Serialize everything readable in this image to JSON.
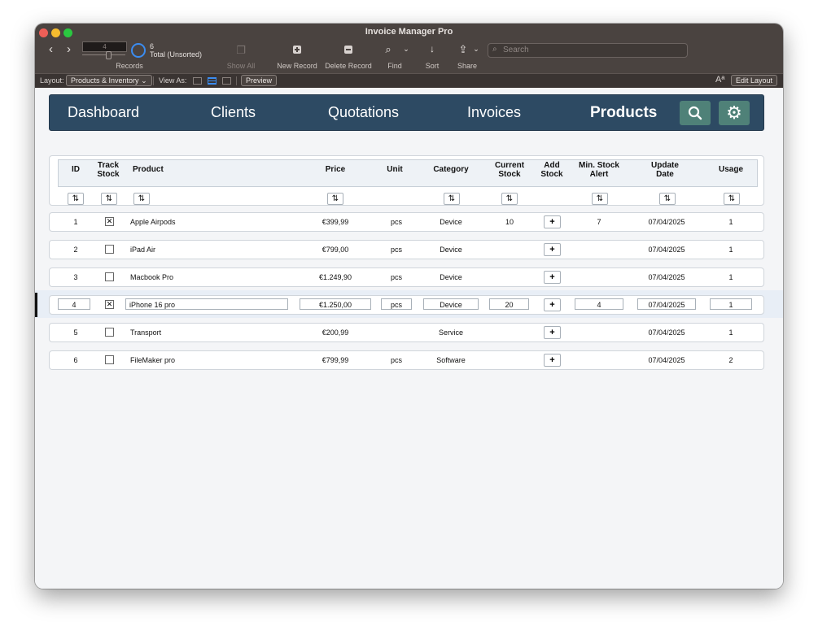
{
  "window": {
    "title": "Invoice Manager Pro"
  },
  "toolbar": {
    "current_record": "4",
    "total_count": "6",
    "total_label": "Total (Unsorted)",
    "records_label": "Records",
    "show_all_label": "Show All",
    "new_record_label": "New Record",
    "delete_record_label": "Delete Record",
    "find_label": "Find",
    "sort_label": "Sort",
    "share_label": "Share",
    "search_placeholder": "Search"
  },
  "layoutbar": {
    "layout_label": "Layout:",
    "layout_value": "Products & Inventory",
    "view_as_label": "View As:",
    "preview_label": "Preview",
    "font_icon_text": "Aª",
    "edit_layout_label": "Edit Layout"
  },
  "nav": {
    "items": [
      {
        "label": "Dashboard"
      },
      {
        "label": "Clients"
      },
      {
        "label": "Quotations"
      },
      {
        "label": "Invoices"
      },
      {
        "label": "Products"
      }
    ],
    "active": "Products"
  },
  "table": {
    "headers": [
      {
        "key": "id",
        "label": "ID"
      },
      {
        "key": "track_stock",
        "label": "Track Stock"
      },
      {
        "key": "product",
        "label": "Product"
      },
      {
        "key": "price",
        "label": "Price"
      },
      {
        "key": "unit",
        "label": "Unit"
      },
      {
        "key": "category",
        "label": "Category"
      },
      {
        "key": "current_stock",
        "label": "Current Stock"
      },
      {
        "key": "add_stock",
        "label": "Add Stock"
      },
      {
        "key": "min_stock_alert",
        "label": "Min. Stock Alert"
      },
      {
        "key": "update_date",
        "label": "Update Date"
      },
      {
        "key": "usage",
        "label": "Usage"
      }
    ],
    "rows": [
      {
        "id": "1",
        "track_stock": true,
        "product": "Apple Airpods",
        "price": "€399,99",
        "unit": "pcs",
        "category": "Device",
        "current_stock": "10",
        "min_stock_alert": "7",
        "update_date": "07/04/2025",
        "usage": "1"
      },
      {
        "id": "2",
        "track_stock": false,
        "product": "iPad Air",
        "price": "€799,00",
        "unit": "pcs",
        "category": "Device",
        "current_stock": "",
        "min_stock_alert": "",
        "update_date": "07/04/2025",
        "usage": "1"
      },
      {
        "id": "3",
        "track_stock": false,
        "product": "Macbook Pro",
        "price": "€1.249,90",
        "unit": "pcs",
        "category": "Device",
        "current_stock": "",
        "min_stock_alert": "",
        "update_date": "07/04/2025",
        "usage": "1"
      },
      {
        "id": "4",
        "track_stock": true,
        "product": "iPhone 16 pro",
        "price": "€1.250,00",
        "unit": "pcs",
        "category": "Device",
        "current_stock": "20",
        "min_stock_alert": "4",
        "update_date": "07/04/2025",
        "usage": "1"
      },
      {
        "id": "5",
        "track_stock": false,
        "product": "Transport",
        "price": "€200,99",
        "unit": "",
        "category": "Service",
        "current_stock": "",
        "min_stock_alert": "",
        "update_date": "07/04/2025",
        "usage": "1"
      },
      {
        "id": "6",
        "track_stock": false,
        "product": "FileMaker pro",
        "price": "€799,99",
        "unit": "pcs",
        "category": "Software",
        "current_stock": "",
        "min_stock_alert": "",
        "update_date": "07/04/2025",
        "usage": "2"
      }
    ],
    "selected_row_index": 3,
    "add_stock_symbol": "+",
    "sort_symbol": "⇅",
    "check_symbol": "✕"
  },
  "colors": {
    "nav_bg": "#2d4a63",
    "nav_button_bg": "#4f8178",
    "titlebar_bg": "#4a4340",
    "accent_blue": "#3b8cf0"
  },
  "icons": {
    "nav_search": "search-icon",
    "nav_settings": "gear-icon"
  }
}
